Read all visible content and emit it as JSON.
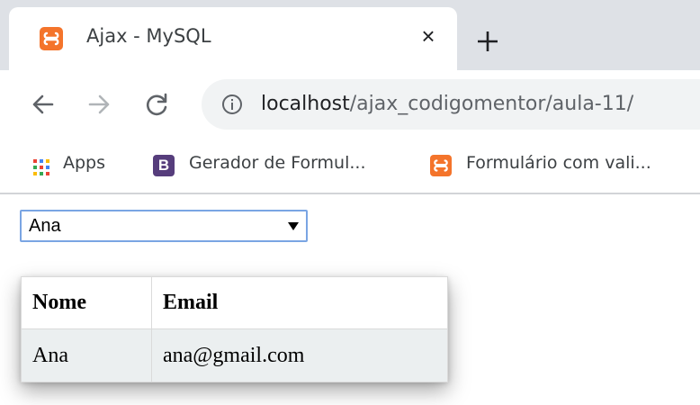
{
  "tab": {
    "title": "Ajax - MySQL",
    "close": "×",
    "favicon": "xampp-favicon-icon"
  },
  "toolbar": {
    "url_host": "localhost",
    "url_path": "/ajax_codigomentor/aula-11/"
  },
  "bookmarks": [
    {
      "label": "Apps",
      "icon": "apps-grid-icon"
    },
    {
      "label": "Gerador de Formul...",
      "icon": "bootstrap-b-icon",
      "badge": "B"
    },
    {
      "label": "Formulário com vali...",
      "icon": "xampp-favicon-icon"
    }
  ],
  "select": {
    "value": "Ana"
  },
  "table": {
    "headers": [
      "Nome",
      "Email"
    ],
    "rows": [
      [
        "Ana",
        "ana@gmail.com"
      ]
    ]
  },
  "colors": {
    "tabstrip": "#dee1e6",
    "omnibox": "#f1f3f4",
    "favicon": "#f4742b",
    "bootstrap": "#563d7c",
    "select_border": "#7aa5e3",
    "row_bg": "#ebeff0"
  }
}
